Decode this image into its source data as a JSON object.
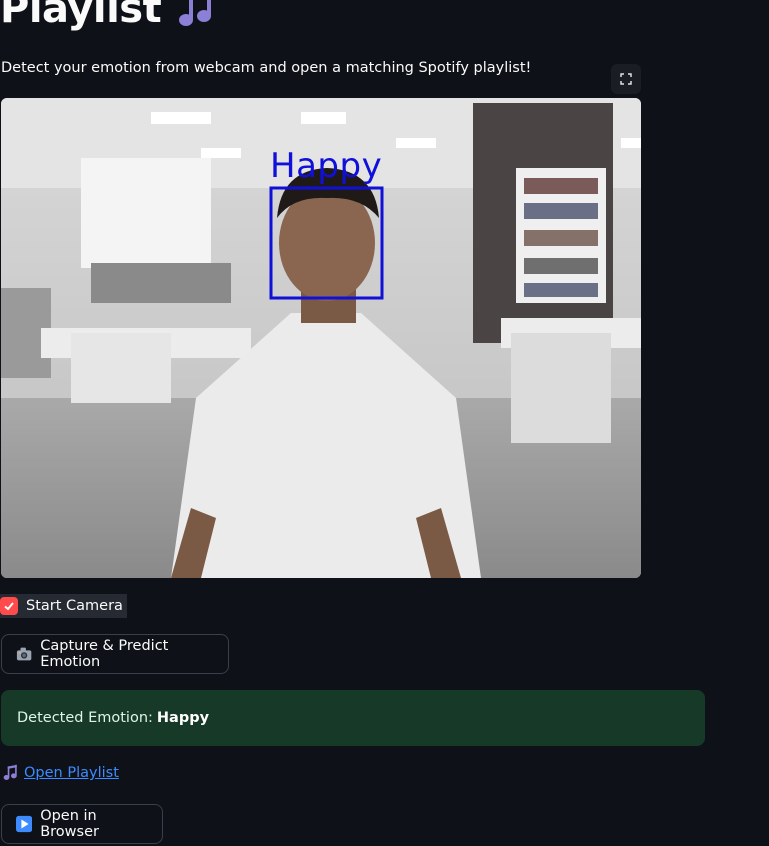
{
  "header": {
    "title": "Playlist",
    "title_icon": "music-notes-icon",
    "subtitle": "Detect your emotion from webcam and open a matching Spotify playlist!"
  },
  "webcam": {
    "overlay_label": "Happy",
    "overlay_color": "#1010d8",
    "fullscreen_icon": "fullscreen-icon"
  },
  "controls": {
    "start_camera_label": "Start Camera",
    "start_camera_checked": true,
    "capture_button_label": "Capture & Predict Emotion",
    "capture_button_icon": "camera-icon"
  },
  "result": {
    "prefix": "Detected Emotion:",
    "emotion": "Happy",
    "background_color": "#173928"
  },
  "links": {
    "playlist_label": "Open Playlist",
    "playlist_icon": "music-notes-icon",
    "browser_button_label": "Open in Browser",
    "browser_button_icon": "play-icon"
  },
  "colors": {
    "background": "#0e1117",
    "accent": "#ff4b4b",
    "link": "#3d8bff"
  }
}
